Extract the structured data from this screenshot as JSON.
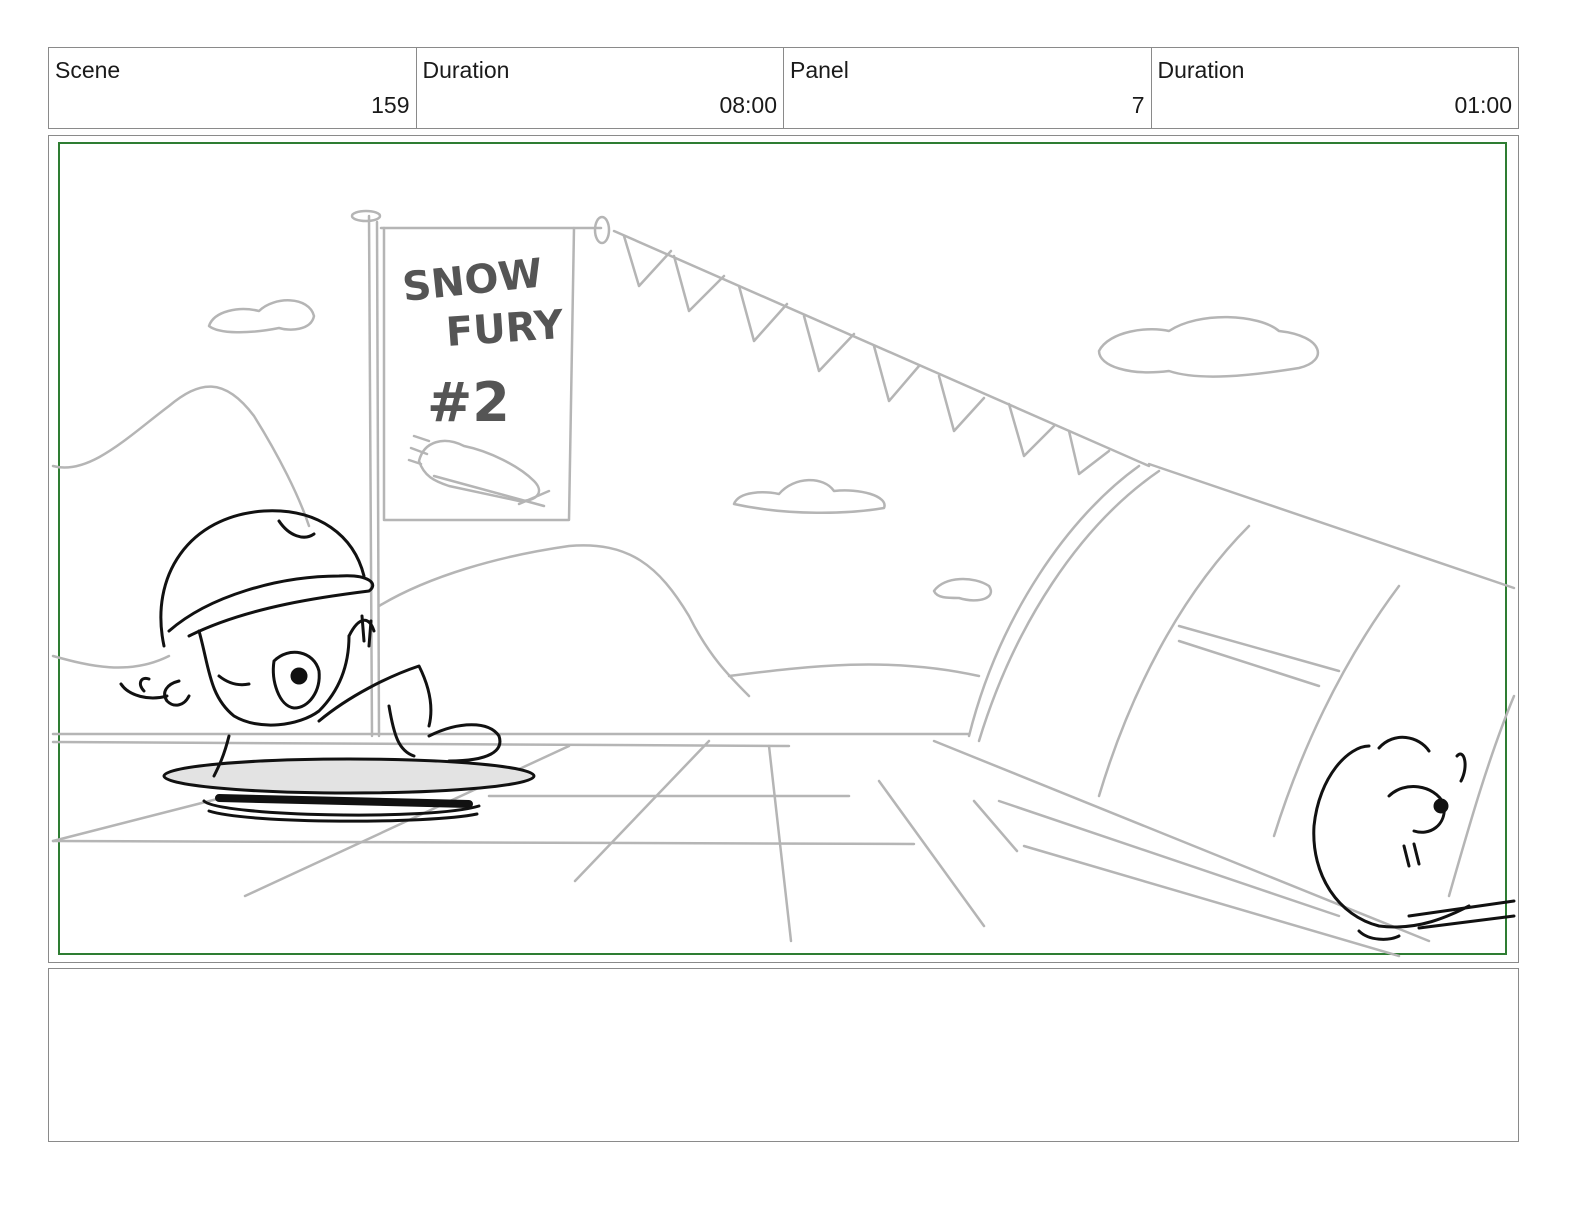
{
  "header": {
    "cells": [
      {
        "label": "Scene",
        "value": "159"
      },
      {
        "label": "Duration",
        "value": "08:00"
      },
      {
        "label": "Panel",
        "value": "7"
      },
      {
        "label": "Duration",
        "value": "01:00"
      }
    ]
  },
  "panel": {
    "banner_lines": [
      "SNOW",
      "FURY",
      "#2"
    ],
    "safe_area_color": "#2e7d32"
  },
  "notes": {
    "text": ""
  }
}
